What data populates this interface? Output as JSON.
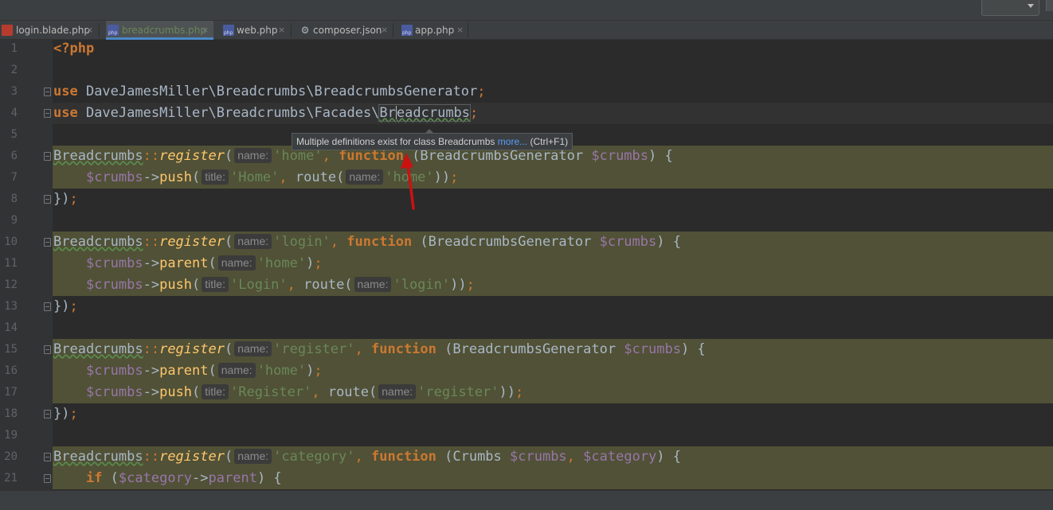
{
  "tabs": [
    {
      "label": "login.blade.php",
      "icon": "blade-file-icon",
      "active": false
    },
    {
      "label": "breadcrumbs.php",
      "icon": "php-file-icon",
      "active": true
    },
    {
      "label": "web.php",
      "icon": "php-file-icon",
      "active": false
    },
    {
      "label": "composer.json",
      "icon": "json-file-icon",
      "active": false
    },
    {
      "label": "app.php",
      "icon": "php-file-icon",
      "active": false
    }
  ],
  "tab_close": "×",
  "php_badge": "php",
  "line_numbers": [
    "1",
    "2",
    "3",
    "4",
    "5",
    "6",
    "7",
    "8",
    "9",
    "10",
    "11",
    "12",
    "13",
    "14",
    "15",
    "16",
    "17",
    "18",
    "19",
    "20",
    "21"
  ],
  "code": {
    "l1_open": "<?php",
    "use_kw": "use",
    "l3_ns": " DaveJamesMiller\\Breadcrumbs\\BreadcrumbsGenerator",
    "l4_ns": " DaveJamesMiller\\Breadcrumbs\\Facades\\",
    "l4_cls_a": "Br",
    "l4_cls_b": "eadcrumbs",
    "semi": ";",
    "cls": "Breadcrumbs",
    "dcolon": "::",
    "register": "register",
    "popen": "(",
    "pclose": ")",
    "comma": ",",
    "function_kw": "function",
    "hint_name": "name:",
    "hint_title": "title:",
    "gen_params": " (BreadcrumbsGenerator ",
    "crumbs_var": "$crumbs",
    "brace_open": ") {",
    "arrow": "->",
    "push": "push",
    "parent": "parent",
    "route": " route(",
    "close_block": "});",
    "close_block_brace": "})",
    "close_paren2": "))",
    "str_home": "'home'",
    "str_Home": "'Home'",
    "str_login": "'login'",
    "str_Login": "'Login'",
    "str_register": "'register'",
    "str_Register": "'Register'",
    "str_category": "'category'",
    "l20_params": " (Crumbs ",
    "category_var": "$category",
    "if_kw": "if",
    "if_open": " (",
    "parent_prop": "parent",
    "if_close": ") {"
  },
  "tooltip": {
    "text": "Multiple definitions exist for class Breadcrumbs ",
    "more": "more...",
    "shortcut": " (Ctrl+F1)"
  },
  "colors": {
    "keyword": "#cc7832",
    "string": "#6a8759",
    "variable": "#9876aa",
    "method": "#ffc66d",
    "highlight": "#505136",
    "annotation_arrow": "#cc1111"
  }
}
